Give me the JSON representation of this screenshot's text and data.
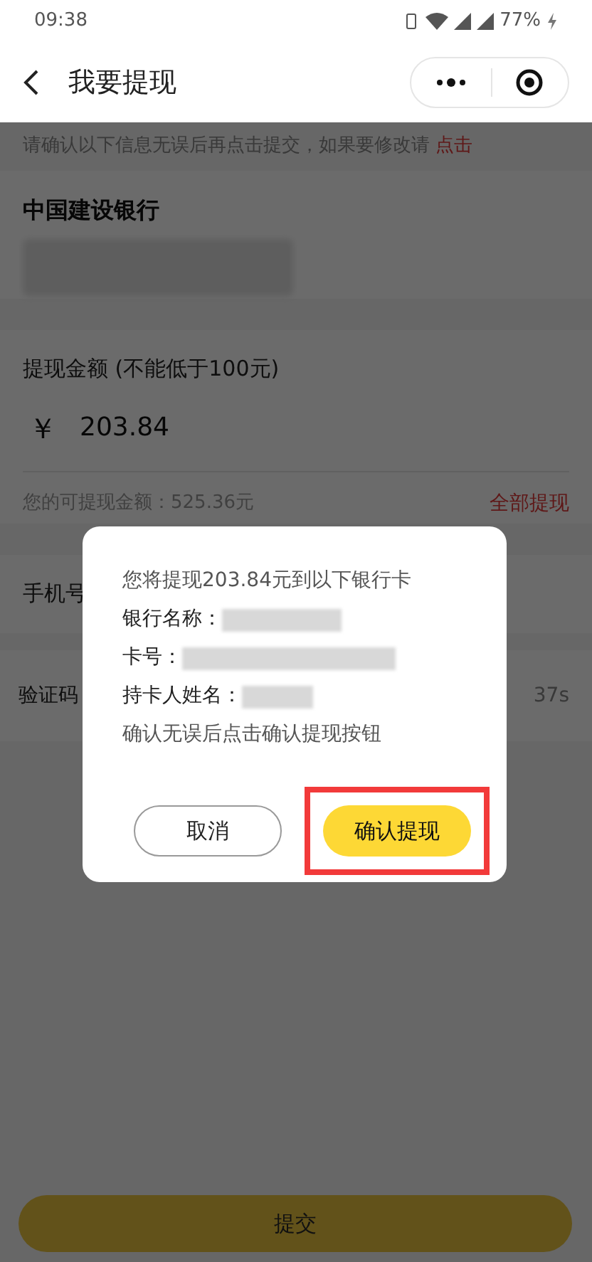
{
  "status_bar": {
    "time": "09:38",
    "battery": "77%"
  },
  "nav": {
    "title": "我要提现"
  },
  "notice": {
    "text": "请确认以下信息无误后再点击提交，如果要修改请",
    "link": "点击"
  },
  "bank": {
    "name": "中国建设银行"
  },
  "amount": {
    "label": "提现金额 (不能低于100元)",
    "currency": "￥",
    "value": "203.84",
    "available": "您的可提现金额：525.36元",
    "withdraw_all": "全部提现"
  },
  "phone": {
    "label": "手机号"
  },
  "code": {
    "label": "验证码",
    "countdown": "37s"
  },
  "submit": "提交",
  "dialog": {
    "message": "您将提现203.84元到以下银行卡",
    "fields": [
      {
        "label": "银行名称："
      },
      {
        "label": "卡号："
      },
      {
        "label": "持卡人姓名："
      }
    ],
    "hint": "确认无误后点击确认提现按钮",
    "cancel": "取消",
    "confirm": "确认提现",
    "confirm_highlighted": true
  }
}
